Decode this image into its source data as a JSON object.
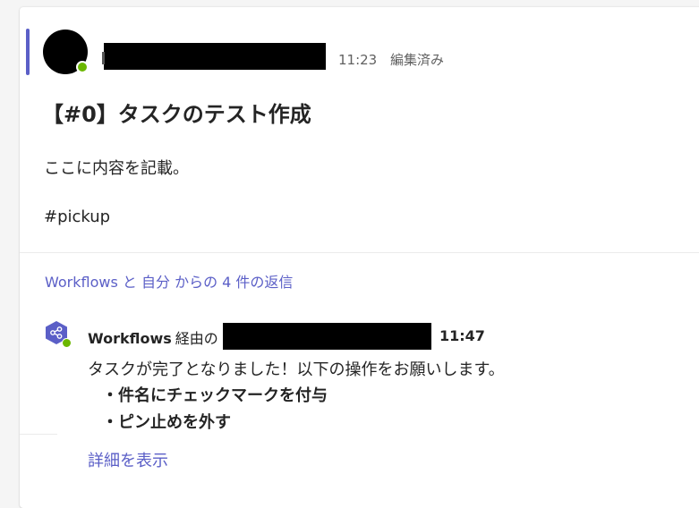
{
  "post": {
    "time": "11:23",
    "edited_label": "編集済み",
    "title": "【#0】タスクのテスト作成",
    "body_lines": [
      "ここに内容を記載。",
      "#pickup"
    ]
  },
  "replies": {
    "summary_link": "Workflows と 自分 からの 4 件の返信"
  },
  "reply": {
    "app_name": "Workflows",
    "via_label": "経由の",
    "time": "11:47",
    "text": "タスクが完了となりました！以下の操作をお願いします。",
    "bullets": [
      "・件名にチェックマークを付与",
      "・ピン止めを外す"
    ],
    "details_link": "詳細を表示"
  },
  "icons": {
    "avatar": "user-avatar",
    "presence": "presence-available-icon",
    "workflows": "workflows-hexagon-icon"
  },
  "colors": {
    "accent": "#5b5fc7",
    "presence_green": "#6bb700",
    "link": "#5b5fc7"
  }
}
